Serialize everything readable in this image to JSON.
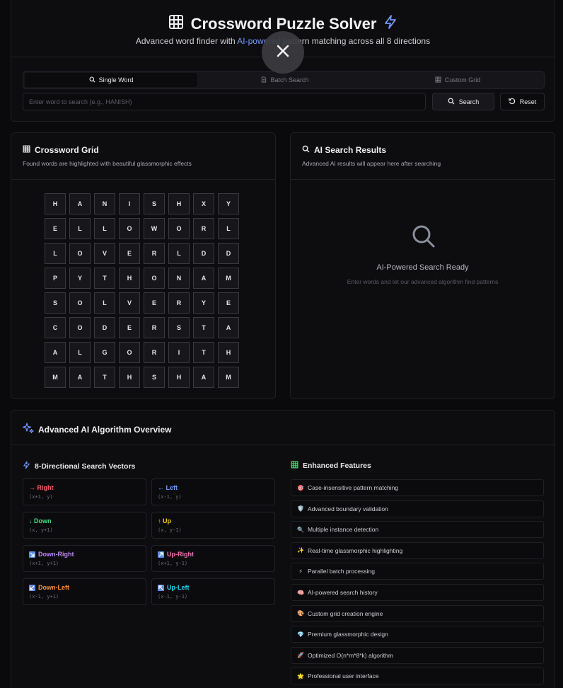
{
  "header": {
    "title": "Crossword Puzzle Solver",
    "subtitle_prefix": "Advanced word finder with ",
    "subtitle_highlight": "AI-powered",
    "subtitle_suffix": " pattern matching across all 8 directions"
  },
  "tabs": [
    {
      "label": "Single Word",
      "icon": "search-icon",
      "active": true
    },
    {
      "label": "Batch Search",
      "icon": "file-icon",
      "active": false
    },
    {
      "label": "Custom Grid",
      "icon": "grid-icon",
      "active": false
    }
  ],
  "search": {
    "placeholder": "Enter word to search (e.g., HANISH)",
    "value": "",
    "search_label": "Search",
    "reset_label": "Reset"
  },
  "grid_card": {
    "title": "Crossword Grid",
    "subtitle": "Found words are highlighted with beautiful glassmorphic effects",
    "rows": [
      [
        "H",
        "A",
        "N",
        "I",
        "S",
        "H",
        "X",
        "Y"
      ],
      [
        "E",
        "L",
        "L",
        "O",
        "W",
        "O",
        "R",
        "L"
      ],
      [
        "L",
        "O",
        "V",
        "E",
        "R",
        "L",
        "D",
        "D"
      ],
      [
        "P",
        "Y",
        "T",
        "H",
        "O",
        "N",
        "A",
        "M"
      ],
      [
        "S",
        "O",
        "L",
        "V",
        "E",
        "R",
        "Y",
        "E"
      ],
      [
        "C",
        "O",
        "D",
        "E",
        "R",
        "S",
        "T",
        "A"
      ],
      [
        "A",
        "L",
        "G",
        "O",
        "R",
        "I",
        "T",
        "H"
      ],
      [
        "M",
        "A",
        "T",
        "H",
        "S",
        "H",
        "A",
        "M"
      ]
    ]
  },
  "results_card": {
    "title": "AI Search Results",
    "subtitle": "Advanced AI results will appear here after searching",
    "ready_title": "AI-Powered Search Ready",
    "ready_sub": "Enter words and let our advanced algorithm find patterns"
  },
  "overview": {
    "title": "Advanced AI Algorithm Overview",
    "vectors_title": "8-Directional Search Vectors",
    "features_title": "Enhanced Features",
    "vectors": [
      {
        "name": "→ Right",
        "coords": "(x+1, y)",
        "color": "#ff5c5c"
      },
      {
        "name": "← Left",
        "coords": "(x-1, y)",
        "color": "#5c9dff"
      },
      {
        "name": "↓ Down",
        "coords": "(x, y+1)",
        "color": "#4ade80"
      },
      {
        "name": "↑ Up",
        "coords": "(x, y-1)",
        "color": "#facc15"
      },
      {
        "name": "Down-Right",
        "coords": "(x+1, y+1)",
        "color": "#c084fc",
        "icon": "arrow-down-right-icon"
      },
      {
        "name": "Up-Right",
        "coords": "(x+1, y-1)",
        "color": "#f472b6",
        "icon": "arrow-up-right-icon"
      },
      {
        "name": "Down-Left",
        "coords": "(x-1, y+1)",
        "color": "#fb923c",
        "icon": "arrow-down-left-icon"
      },
      {
        "name": "Up-Left",
        "coords": "(x-1, y-1)",
        "color": "#22d3ee",
        "icon": "arrow-up-left-icon"
      }
    ],
    "features": [
      {
        "icon": "🎯",
        "label": "Case-insensitive pattern matching"
      },
      {
        "icon": "🛡️",
        "label": "Advanced boundary validation"
      },
      {
        "icon": "🔍",
        "label": "Multiple instance detection"
      },
      {
        "icon": "✨",
        "label": "Real-time glassmorphic highlighting"
      },
      {
        "icon": "⚡",
        "label": "Parallel batch processing"
      },
      {
        "icon": "🧠",
        "label": "AI-powered search history"
      },
      {
        "icon": "🎨",
        "label": "Custom grid creation engine"
      },
      {
        "icon": "💎",
        "label": "Premium glassmorphic design"
      },
      {
        "icon": "🚀",
        "label": "Optimized O(n*m*8*k) algorithm"
      },
      {
        "icon": "🌟",
        "label": "Professional user interface"
      }
    ]
  },
  "colors": {
    "accent": "#6f98ff",
    "features_icon": "#4ade80"
  }
}
